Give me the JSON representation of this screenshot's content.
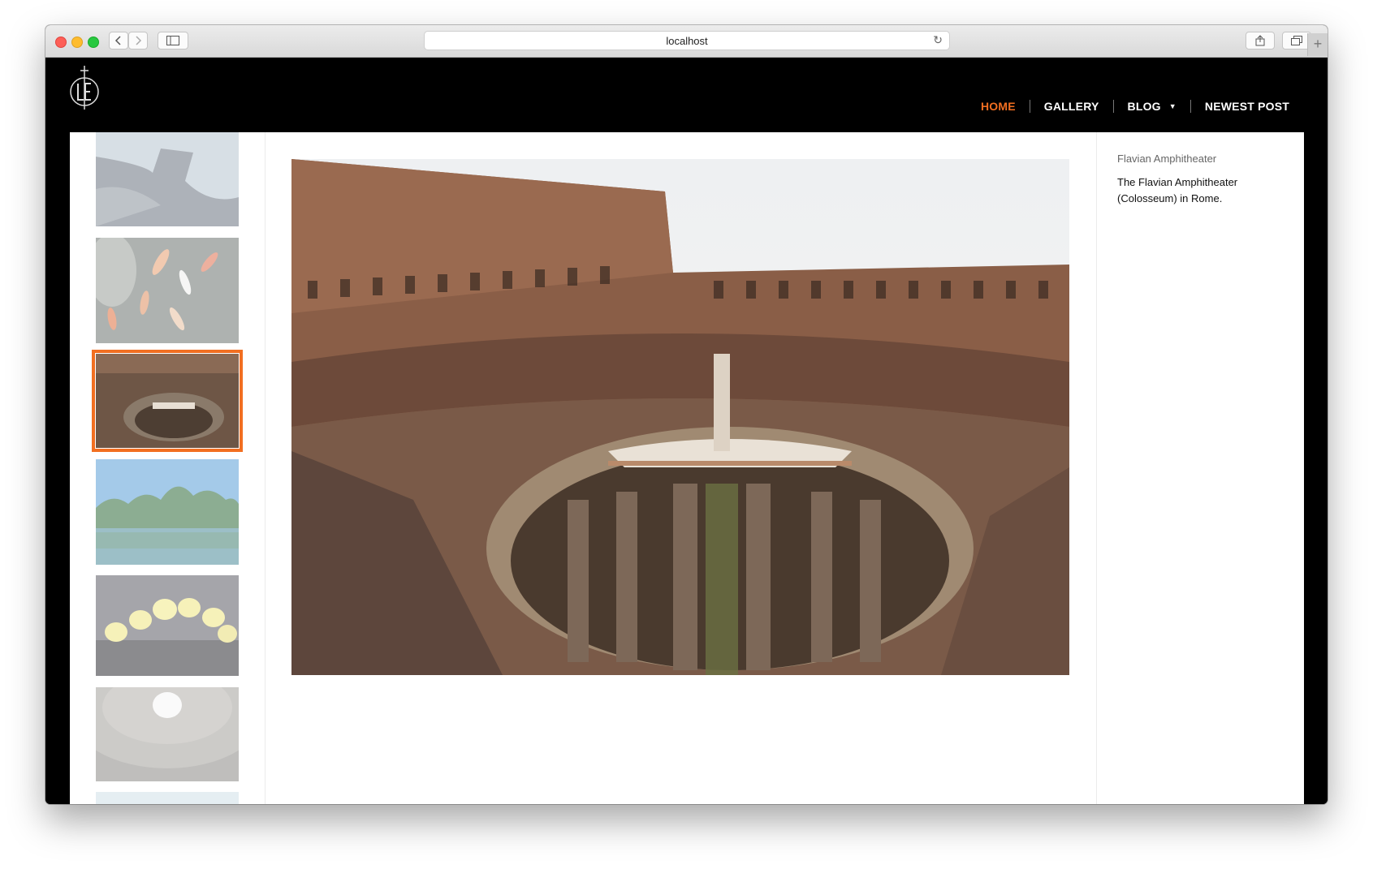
{
  "browser": {
    "url": "localhost",
    "back_icon": "chevron-left-icon",
    "forward_icon": "chevron-right-icon",
    "sidebar_icon": "sidebar-icon",
    "reload_icon": "reload-icon",
    "share_icon": "share-icon",
    "tabs_icon": "tabs-icon",
    "new_tab_icon": "plus-icon"
  },
  "nav": {
    "items": [
      {
        "label": "HOME",
        "active": true
      },
      {
        "label": "GALLERY",
        "active": false
      },
      {
        "label": "BLOG",
        "active": false,
        "has_dropdown": true
      },
      {
        "label": "NEWEST POST",
        "active": false
      }
    ],
    "accent_color": "#f26f21"
  },
  "gallery": {
    "thumbnails": [
      {
        "subject": "modern-architecture",
        "selected": false
      },
      {
        "subject": "koi-pond",
        "selected": false
      },
      {
        "subject": "colosseum",
        "selected": true
      },
      {
        "subject": "lake-with-trees",
        "selected": false
      },
      {
        "subject": "yellow-orchids",
        "selected": false
      },
      {
        "subject": "pantheon-dome",
        "selected": false
      },
      {
        "subject": "partial-thumbnail",
        "selected": false
      }
    ]
  },
  "photo": {
    "title": "Flavian Amphitheater",
    "description": "The Flavian Amphitheater (Colosseum) in Rome."
  }
}
